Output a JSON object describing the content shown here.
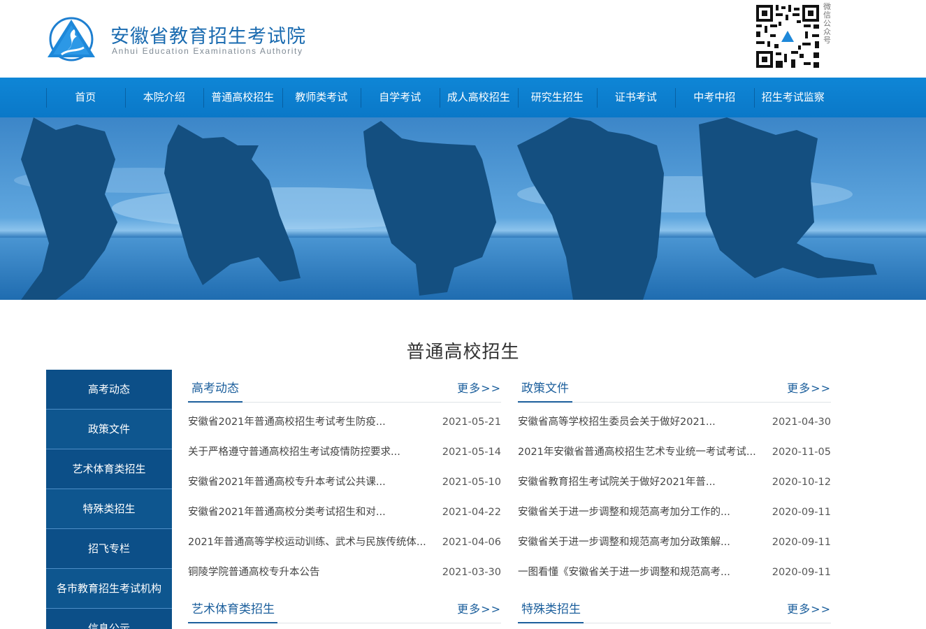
{
  "header": {
    "title": "安徽省教育招生考试院",
    "subtitle": "Anhui Education Examinations Authority",
    "qr_label": "微信公众号",
    "logo_icon": "triangle-flame-logo-icon",
    "qr_icon": "qr-code-icon",
    "brand_color": "#1a6bb0"
  },
  "nav": {
    "items": [
      "首页",
      "本院介绍",
      "普通高校招生",
      "教师类考试",
      "自学考试",
      "成人高校招生",
      "研究生招生",
      "证书考试",
      "中考中招",
      "招生考试监察"
    ]
  },
  "page": {
    "section_title": "普通高校招生"
  },
  "sidebar": {
    "items": [
      "高考动态",
      "政策文件",
      "艺术体育类招生",
      "特殊类招生",
      "招飞专栏",
      "各市教育招生考试机构",
      "信息公示"
    ]
  },
  "panels": [
    {
      "title": "高考动态",
      "more": "更多>>",
      "rows": [
        {
          "text": "安徽省2021年普通高校招生考试考生防疫...",
          "date": "2021-05-21"
        },
        {
          "text": "关于严格遵守普通高校招生考试疫情防控要求...",
          "date": "2021-05-14"
        },
        {
          "text": "安徽省2021年普通高校专升本考试公共课...",
          "date": "2021-05-10"
        },
        {
          "text": "安徽省2021年普通高校分类考试招生和对...",
          "date": "2021-04-22"
        },
        {
          "text": "2021年普通高等学校运动训练、武术与民族传统体...",
          "date": "2021-04-06"
        },
        {
          "text": "铜陵学院普通高校专升本公告",
          "date": "2021-03-30"
        }
      ]
    },
    {
      "title": "政策文件",
      "more": "更多>>",
      "rows": [
        {
          "text": "安徽省高等学校招生委员会关于做好2021...",
          "date": "2021-04-30"
        },
        {
          "text": "2021年安徽省普通高校招生艺术专业统一考试考试...",
          "date": "2020-11-05"
        },
        {
          "text": "安徽省教育招生考试院关于做好2021年普...",
          "date": "2020-10-12"
        },
        {
          "text": "安徽省关于进一步调整和规范高考加分工作的...",
          "date": "2020-09-11"
        },
        {
          "text": "安徽省关于进一步调整和规范高考加分政策解...",
          "date": "2020-09-11"
        },
        {
          "text": "一图看懂《安徽省关于进一步调整和规范高考...",
          "date": "2020-09-11"
        }
      ]
    },
    {
      "title": "艺术体育类招生",
      "more": "更多>>",
      "rows": []
    },
    {
      "title": "特殊类招生",
      "more": "更多>>",
      "rows": []
    }
  ]
}
